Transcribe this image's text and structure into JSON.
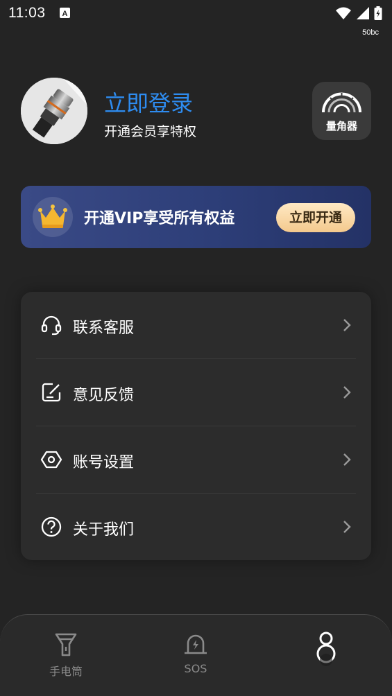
{
  "status_bar": {
    "time": "11:03",
    "net_speed": "50bc",
    "icons": [
      "a-notification-icon",
      "wifi-icon",
      "signal-icon",
      "battery-icon"
    ]
  },
  "profile": {
    "login_title": "立即登录",
    "subtitle": "开通会员享特权",
    "protractor_label": "量角器"
  },
  "vip": {
    "text": "开通VIP享受所有权益",
    "button": "立即开通"
  },
  "menu": {
    "items": [
      {
        "label": "联系客服",
        "icon": "headset-icon"
      },
      {
        "label": "意见反馈",
        "icon": "feedback-icon"
      },
      {
        "label": "账号设置",
        "icon": "settings-hex-icon"
      },
      {
        "label": "关于我们",
        "icon": "help-icon"
      }
    ]
  },
  "nav": {
    "tabs": [
      {
        "label": "手电筒",
        "icon": "flashlight-icon"
      },
      {
        "label": "SOS",
        "icon": "alarm-icon"
      },
      {
        "label": "",
        "icon": "profile-icon"
      }
    ]
  },
  "colors": {
    "background": "#242424",
    "accent_blue": "#2e8cf0",
    "vip_gold": "#f4c98d",
    "card": "#2c2c2c"
  }
}
